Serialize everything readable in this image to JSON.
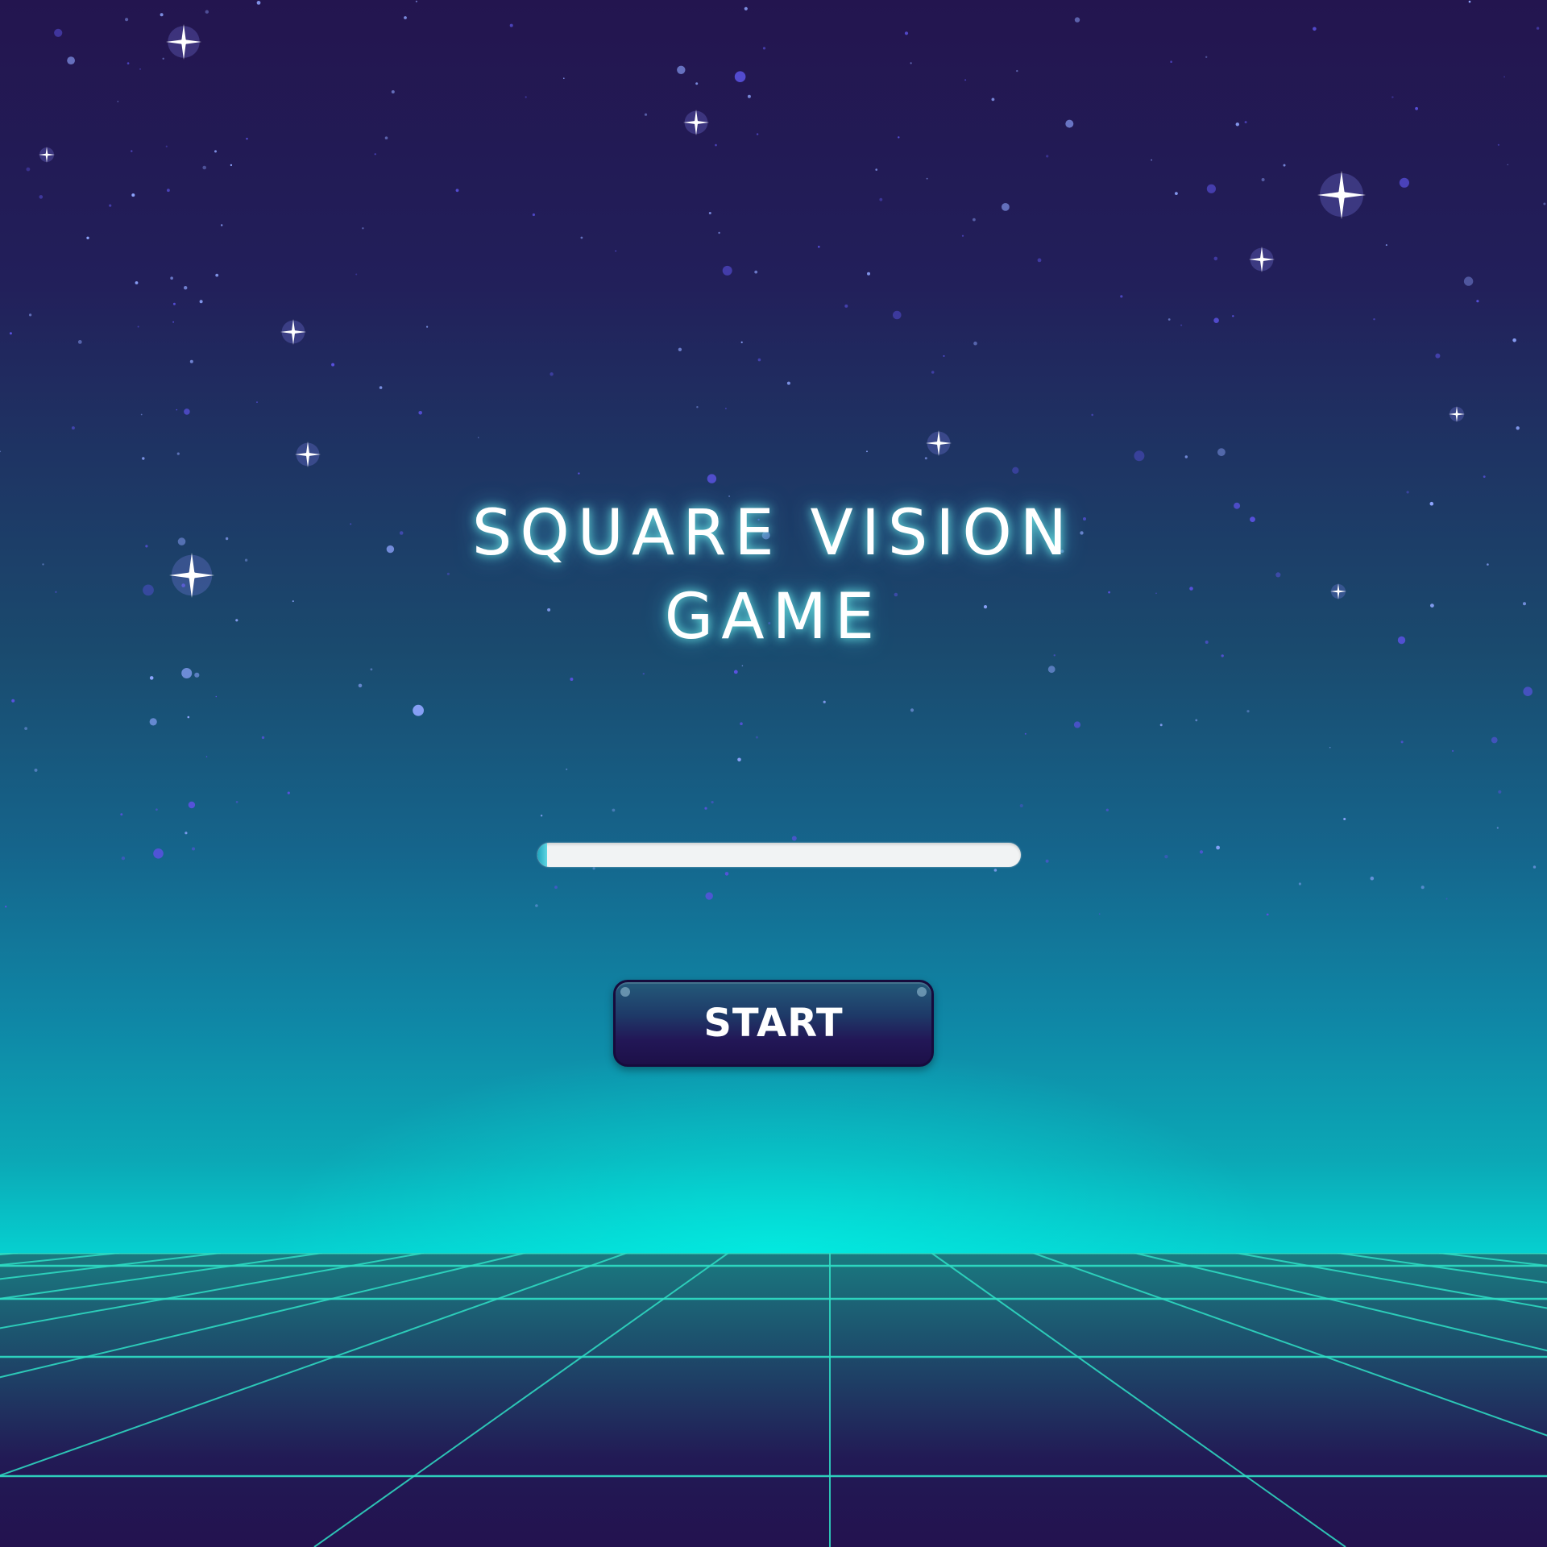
{
  "game": {
    "title_line1": "SQUARE VISION",
    "title_line2": "GAME"
  },
  "loading": {
    "progress": 0.02
  },
  "start_button": {
    "label": "START"
  },
  "colors": {
    "sky_top": "#23154f",
    "sky_horizon": "#03eedf",
    "grid_line": "#2fe0c6",
    "floor": "#221550",
    "button_bg": "#221757",
    "text_glow": "#78fff5"
  }
}
